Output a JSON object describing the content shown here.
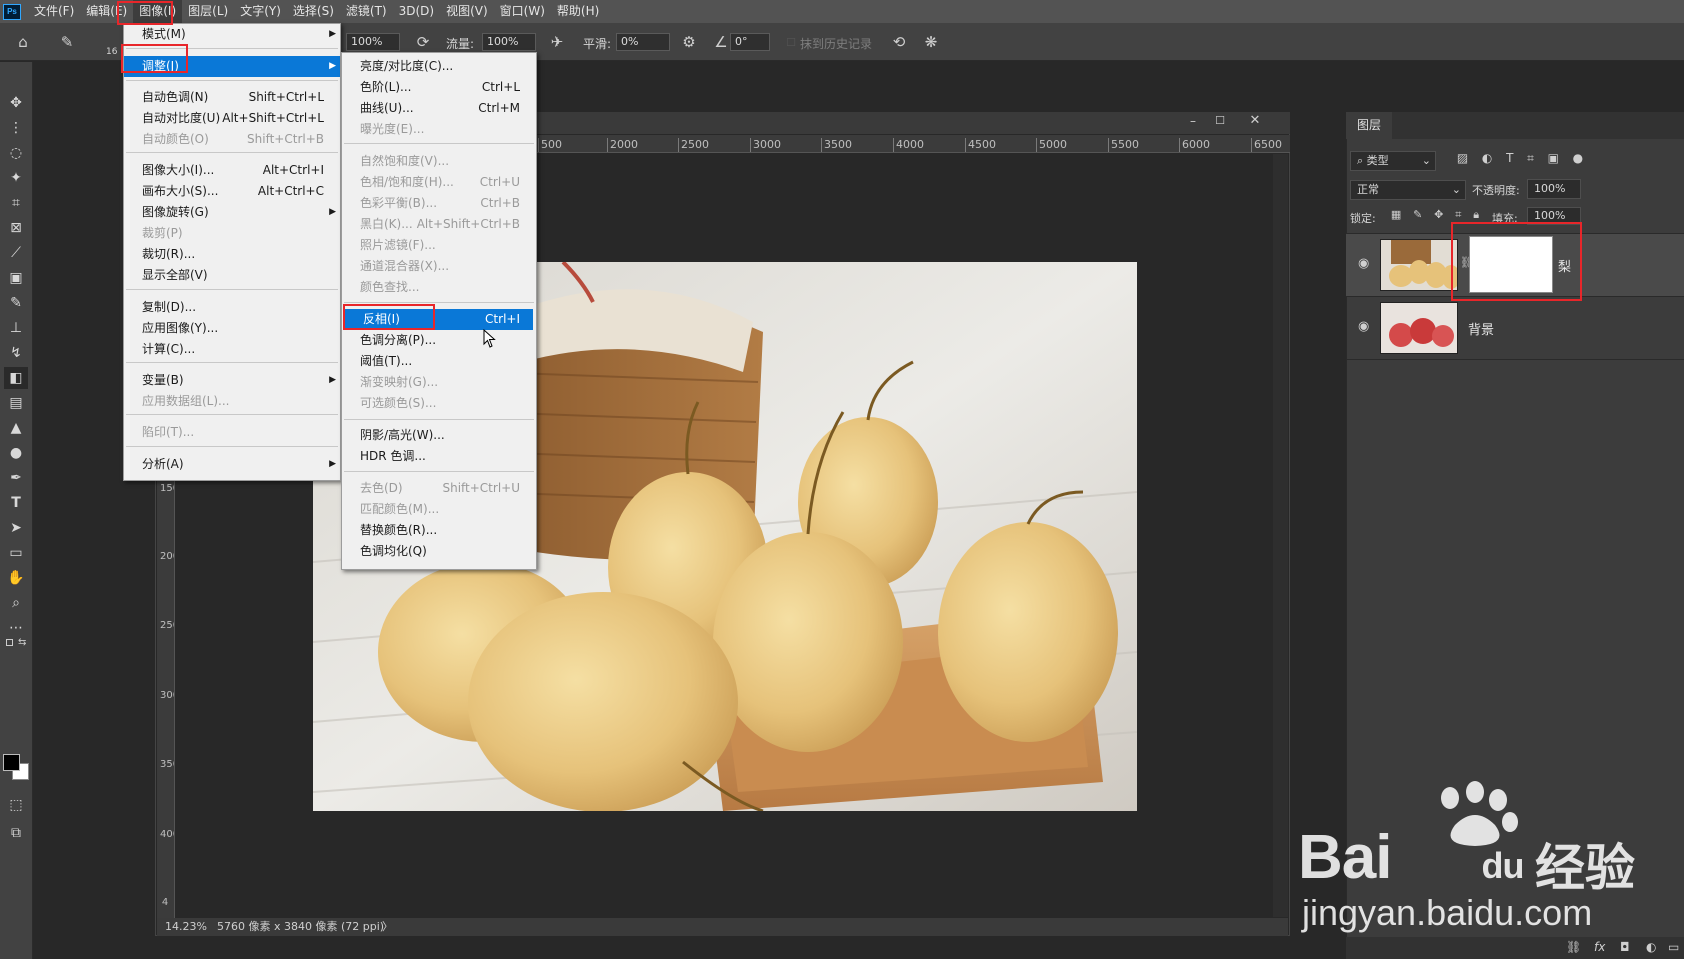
{
  "app": {
    "logo_text": "Ps"
  },
  "menubar": {
    "items": [
      "文件(F)",
      "编辑(E)",
      "图像(I)",
      "图层(L)",
      "文字(Y)",
      "选择(S)",
      "滤镜(T)",
      "3D(D)",
      "视图(V)",
      "窗口(W)",
      "帮助(H)"
    ]
  },
  "options": {
    "brush_size": "16",
    "opacity_value": "100%",
    "flow_label": "流量:",
    "flow_value": "100%",
    "smoothing_label": "平滑:",
    "smoothing_value": "0%",
    "angle_value": "0°",
    "erase_history_label": "抹到历史记录"
  },
  "image_menu": {
    "items": [
      {
        "label": "模式(M)",
        "shortcut": "",
        "submenu": true,
        "disabled": false
      },
      {
        "label": "调整(J)",
        "shortcut": "",
        "submenu": true,
        "disabled": false,
        "highlight": true
      },
      {
        "label": "自动色调(N)",
        "shortcut": "Shift+Ctrl+L",
        "disabled": false
      },
      {
        "label": "自动对比度(U)",
        "shortcut": "Alt+Shift+Ctrl+L",
        "disabled": false
      },
      {
        "label": "自动颜色(O)",
        "shortcut": "Shift+Ctrl+B",
        "disabled": true
      },
      {
        "label": "图像大小(I)...",
        "shortcut": "Alt+Ctrl+I",
        "disabled": false
      },
      {
        "label": "画布大小(S)...",
        "shortcut": "Alt+Ctrl+C",
        "disabled": false
      },
      {
        "label": "图像旋转(G)",
        "shortcut": "",
        "submenu": true,
        "disabled": false
      },
      {
        "label": "裁剪(P)",
        "shortcut": "",
        "disabled": true
      },
      {
        "label": "裁切(R)...",
        "shortcut": "",
        "disabled": false
      },
      {
        "label": "显示全部(V)",
        "shortcut": "",
        "disabled": false
      },
      {
        "label": "复制(D)...",
        "shortcut": "",
        "disabled": false
      },
      {
        "label": "应用图像(Y)...",
        "shortcut": "",
        "disabled": false
      },
      {
        "label": "计算(C)...",
        "shortcut": "",
        "disabled": false
      },
      {
        "label": "变量(B)",
        "shortcut": "",
        "submenu": true,
        "disabled": false
      },
      {
        "label": "应用数据组(L)...",
        "shortcut": "",
        "disabled": true
      },
      {
        "label": "陷印(T)...",
        "shortcut": "",
        "disabled": true
      },
      {
        "label": "分析(A)",
        "shortcut": "",
        "submenu": true,
        "disabled": false
      }
    ]
  },
  "adjust_menu": {
    "items": [
      {
        "label": "亮度/对比度(C)...",
        "shortcut": "",
        "disabled": false
      },
      {
        "label": "色阶(L)...",
        "shortcut": "Ctrl+L",
        "disabled": false
      },
      {
        "label": "曲线(U)...",
        "shortcut": "Ctrl+M",
        "disabled": false
      },
      {
        "label": "曝光度(E)...",
        "shortcut": "",
        "disabled": true
      },
      {
        "label": "自然饱和度(V)...",
        "shortcut": "",
        "disabled": true
      },
      {
        "label": "色相/饱和度(H)...",
        "shortcut": "Ctrl+U",
        "disabled": true
      },
      {
        "label": "色彩平衡(B)...",
        "shortcut": "Ctrl+B",
        "disabled": true
      },
      {
        "label": "黑白(K)...",
        "shortcut": "Alt+Shift+Ctrl+B",
        "disabled": true
      },
      {
        "label": "照片滤镜(F)...",
        "shortcut": "",
        "disabled": true
      },
      {
        "label": "通道混合器(X)...",
        "shortcut": "",
        "disabled": true
      },
      {
        "label": "颜色查找...",
        "shortcut": "",
        "disabled": true
      },
      {
        "label": "反相(I)",
        "shortcut": "Ctrl+I",
        "disabled": false,
        "highlight": true
      },
      {
        "label": "色调分离(P)...",
        "shortcut": "",
        "disabled": false
      },
      {
        "label": "阈值(T)...",
        "shortcut": "",
        "disabled": false
      },
      {
        "label": "渐变映射(G)...",
        "shortcut": "",
        "disabled": true
      },
      {
        "label": "可选颜色(S)...",
        "shortcut": "",
        "disabled": true
      },
      {
        "label": "阴影/高光(W)...",
        "shortcut": "",
        "disabled": false
      },
      {
        "label": "HDR 色调...",
        "shortcut": "",
        "disabled": false
      },
      {
        "label": "去色(D)",
        "shortcut": "Shift+Ctrl+U",
        "disabled": true
      },
      {
        "label": "匹配颜色(M)...",
        "shortcut": "",
        "disabled": true
      },
      {
        "label": "替换颜色(R)...",
        "shortcut": "",
        "disabled": false
      },
      {
        "label": "色调均化(Q)",
        "shortcut": "",
        "disabled": false
      }
    ]
  },
  "ruler": {
    "top_ticks": [
      "500",
      "2000",
      "2500",
      "3000",
      "3500",
      "4000",
      "4500",
      "5000",
      "5500",
      "6000",
      "6500"
    ],
    "left_ticks": [
      "1500",
      "2000",
      "2500",
      "3000",
      "3500",
      "4000",
      "4"
    ]
  },
  "status": {
    "zoom": "14.23%",
    "doc_info": "5760 像素 x 3840 像素 (72 ppi)",
    "arrow": "〉"
  },
  "layers_panel": {
    "tab_label": "图层",
    "filter_label": "类型",
    "blend_mode": "正常",
    "opacity_label": "不透明度:",
    "opacity_value": "100%",
    "lock_label": "锁定:",
    "fill_label": "填充:",
    "fill_value": "100%",
    "layers": [
      {
        "name": "梨"
      },
      {
        "name": "背景"
      }
    ]
  },
  "watermark": {
    "brand": "Bai",
    "brand2": "du",
    "cn": "经验",
    "url": "jingyan.baidu.com"
  },
  "colors": {
    "highlight": "#0a78d7",
    "annotation": "#e8262a",
    "menu_bg": "#f0f0f0"
  }
}
